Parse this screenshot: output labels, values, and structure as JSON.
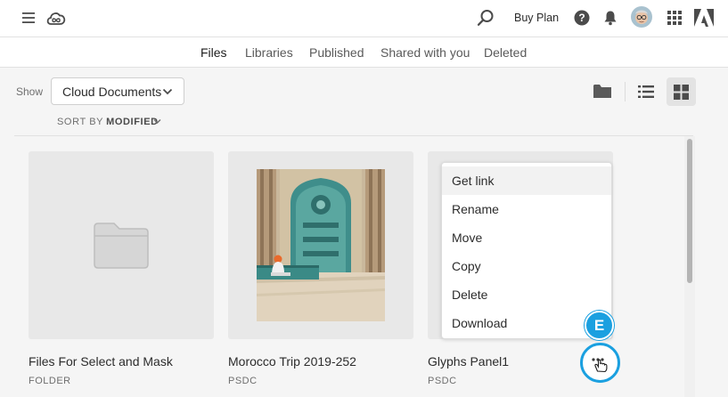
{
  "header": {
    "buy_plan": "Buy Plan",
    "icons": [
      "hamburger-icon",
      "creative-cloud-logo-icon",
      "search-icon",
      "help-icon",
      "bell-icon",
      "avatar",
      "apps-grid-icon",
      "adobe-logo-icon"
    ]
  },
  "tabs": [
    {
      "label": "Files",
      "active": true
    },
    {
      "label": "Libraries",
      "active": false
    },
    {
      "label": "Published",
      "active": false
    },
    {
      "label": "Shared with you",
      "active": false
    },
    {
      "label": "Deleted",
      "active": false
    }
  ],
  "filter": {
    "show_label": "Show",
    "selected": "Cloud Documents"
  },
  "sort": {
    "label": "SORT BY",
    "value": "MODIFIED"
  },
  "view_modes": [
    "folder-view-icon",
    "list-view-icon",
    "grid-view-icon"
  ],
  "active_view": "grid",
  "cards": [
    {
      "name": "Files For Select and Mask",
      "type": "FOLDER"
    },
    {
      "name": "Morocco Trip 2019-252",
      "type": "PSDC"
    },
    {
      "name": "Glyphs Panel1",
      "type": "PSDC"
    }
  ],
  "context_menu": {
    "items": [
      "Get link",
      "Rename",
      "Move",
      "Copy",
      "Delete",
      "Download"
    ],
    "highlighted": "Get link"
  },
  "callout": {
    "letter": "E"
  },
  "colors": {
    "accent": "#1ba0e0",
    "card_bg": "#e8e8e8",
    "page_bg": "#f5f5f5"
  }
}
